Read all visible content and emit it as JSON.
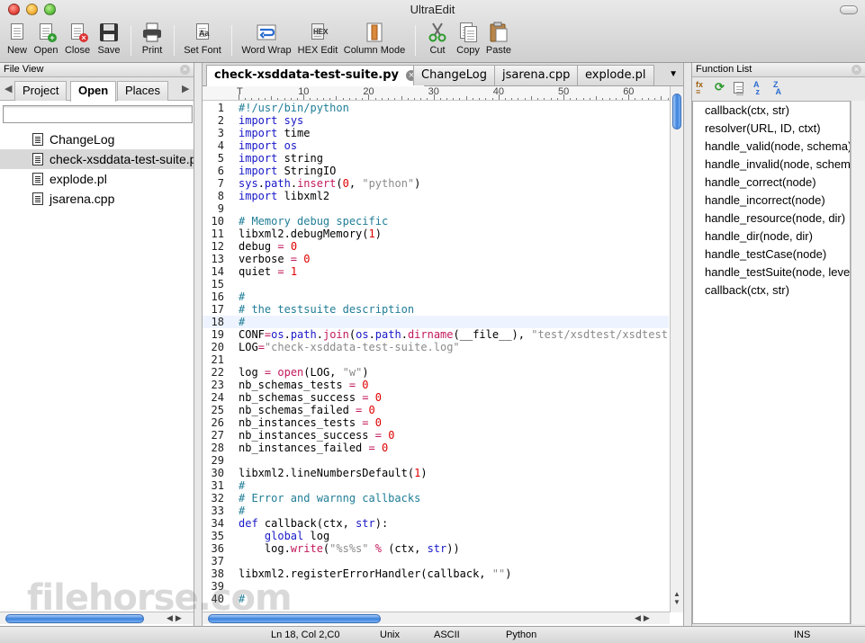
{
  "app": {
    "title": "UltraEdit"
  },
  "toolbar": {
    "new": "New",
    "open": "Open",
    "close": "Close",
    "save": "Save",
    "print": "Print",
    "set_font": "Set Font",
    "word_wrap": "Word Wrap",
    "hex_edit": "HEX Edit",
    "column_mode": "Column Mode",
    "cut": "Cut",
    "copy": "Copy",
    "paste": "Paste"
  },
  "file_view": {
    "title": "File View",
    "tabs": [
      "Project",
      "Open",
      "Places"
    ],
    "active_tab": "Open",
    "files": [
      "ChangeLog",
      "check-xsddata-test-suite.py",
      "explode.pl",
      "jsarena.cpp"
    ],
    "selected_file": "check-xsddata-test-suite.py"
  },
  "editor": {
    "tabs": [
      "check-xsddata-test-suite.py",
      "ChangeLog",
      "jsarena.cpp",
      "explode.pl"
    ],
    "active_tab": "check-xsddata-test-suite.py",
    "ruler": [
      "T",
      "10",
      "20",
      "30",
      "40",
      "50",
      "60"
    ],
    "current_line": 18,
    "lines": [
      {
        "n": "1",
        "t": "#!/usr/bin/python"
      },
      {
        "n": "2",
        "t": "import sys"
      },
      {
        "n": "3",
        "t": "import time"
      },
      {
        "n": "4",
        "t": "import os"
      },
      {
        "n": "5",
        "t": "import string"
      },
      {
        "n": "6",
        "t": "import StringIO"
      },
      {
        "n": "7",
        "t": "sys.path.insert(0, \"python\")"
      },
      {
        "n": "8",
        "t": "import libxml2"
      },
      {
        "n": "9",
        "t": ""
      },
      {
        "n": "10",
        "t": "# Memory debug specific"
      },
      {
        "n": "11",
        "t": "libxml2.debugMemory(1)"
      },
      {
        "n": "12",
        "t": "debug = 0"
      },
      {
        "n": "13",
        "t": "verbose = 0"
      },
      {
        "n": "14",
        "t": "quiet = 1"
      },
      {
        "n": "15",
        "t": ""
      },
      {
        "n": "16",
        "t": "#"
      },
      {
        "n": "17",
        "t": "# the testsuite description"
      },
      {
        "n": "18",
        "t": "#"
      },
      {
        "n": "19",
        "t": "CONF=os.path.join(os.path.dirname(__file__), \"test/xsdtest/xsdtestsuite.xml\")"
      },
      {
        "n": "20",
        "t": "LOG=\"check-xsddata-test-suite.log\""
      },
      {
        "n": "21",
        "t": ""
      },
      {
        "n": "22",
        "t": "log = open(LOG, \"w\")"
      },
      {
        "n": "23",
        "t": "nb_schemas_tests = 0"
      },
      {
        "n": "24",
        "t": "nb_schemas_success = 0"
      },
      {
        "n": "25",
        "t": "nb_schemas_failed = 0"
      },
      {
        "n": "26",
        "t": "nb_instances_tests = 0"
      },
      {
        "n": "27",
        "t": "nb_instances_success = 0"
      },
      {
        "n": "28",
        "t": "nb_instances_failed = 0"
      },
      {
        "n": "29",
        "t": ""
      },
      {
        "n": "30",
        "t": "libxml2.lineNumbersDefault(1)"
      },
      {
        "n": "31",
        "t": "#"
      },
      {
        "n": "32",
        "t": "# Error and warnng callbacks"
      },
      {
        "n": "33",
        "t": "#"
      },
      {
        "n": "34",
        "t": "def callback(ctx, str):"
      },
      {
        "n": "35",
        "t": "    global log"
      },
      {
        "n": "36",
        "t": "    log.write(\"%s%s\" % (ctx, str))"
      },
      {
        "n": "37",
        "t": ""
      },
      {
        "n": "38",
        "t": "libxml2.registerErrorHandler(callback, \"\")"
      },
      {
        "n": "39",
        "t": ""
      },
      {
        "n": "40",
        "t": "#"
      }
    ]
  },
  "function_list": {
    "title": "Function List",
    "items": [
      "callback(ctx, str)",
      "resolver(URL, ID, ctxt)",
      "handle_valid(node, schema)",
      "handle_invalid(node, schema)",
      "handle_correct(node)",
      "handle_incorrect(node)",
      "handle_resource(node, dir)",
      "handle_dir(node, dir)",
      "handle_testCase(node)",
      "handle_testSuite(node, level)",
      "callback(ctx, str)"
    ]
  },
  "status": {
    "position": "Ln 18, Col 2,C0",
    "line_ending": "Unix",
    "encoding": "ASCII",
    "syntax": "Python",
    "mode": "INS"
  },
  "watermark": "filehorse.com",
  "colors": {
    "keyword": "#1818c8",
    "comment": "#1f7d96",
    "string": "#8a8a8a",
    "number": "#e00000",
    "scroll_accent": "#3d83dc"
  }
}
